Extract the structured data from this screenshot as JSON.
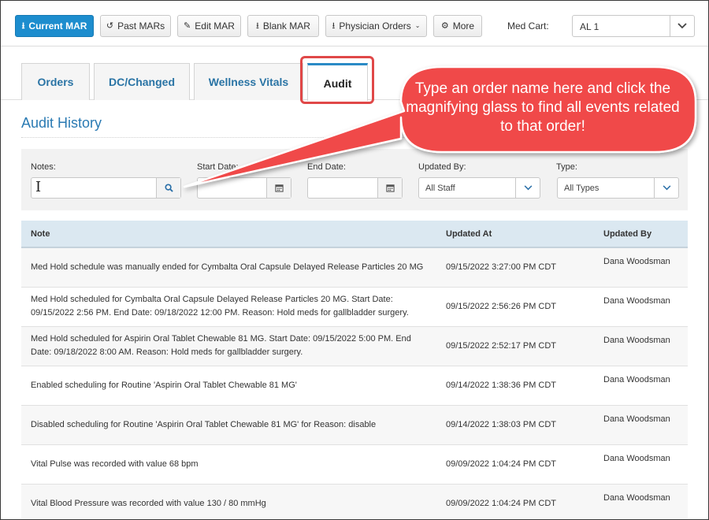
{
  "toolbar": {
    "buttons": [
      {
        "label": "Current MAR",
        "icon": "download-icon"
      },
      {
        "label": "Past MARs",
        "icon": "history-icon"
      },
      {
        "label": "Edit MAR",
        "icon": "pencil-icon"
      },
      {
        "label": "Blank MAR",
        "icon": "download-icon"
      },
      {
        "label": "Physician Orders",
        "icon": "download-icon"
      },
      {
        "label": "More",
        "icon": "gear-icon"
      }
    ],
    "med_cart_label": "Med Cart:",
    "med_cart_value": "AL 1"
  },
  "tabs": [
    {
      "label": "Orders",
      "active": false
    },
    {
      "label": "DC/Changed",
      "active": false
    },
    {
      "label": "Wellness Vitals",
      "active": false
    },
    {
      "label": "Audit",
      "active": true
    }
  ],
  "page_title": "Audit History",
  "filters": {
    "notes_label": "Notes:",
    "notes_value": "",
    "start_date_label": "Start Date:",
    "start_date_value": "",
    "end_date_label": "End Date:",
    "end_date_value": "",
    "updated_by_label": "Updated By:",
    "updated_by_value": "All Staff",
    "type_label": "Type:",
    "type_value": "All Types"
  },
  "table": {
    "columns": [
      "Note",
      "Updated At",
      "Updated By"
    ],
    "rows": [
      {
        "note": "Med Hold schedule was manually ended for Cymbalta Oral Capsule Delayed Release Particles 20 MG",
        "updated_at": "09/15/2022 3:27:00 PM CDT",
        "updated_by": "Dana Woodsman"
      },
      {
        "note": "Med Hold scheduled for Cymbalta Oral Capsule Delayed Release Particles 20 MG. Start Date: 09/15/2022 2:56 PM. End Date: 09/18/2022 12:00 PM. Reason: Hold meds for gallbladder surgery.",
        "updated_at": "09/15/2022 2:56:26 PM CDT",
        "updated_by": "Dana Woodsman"
      },
      {
        "note": "Med Hold scheduled for Aspirin Oral Tablet Chewable 81 MG. Start Date: 09/15/2022 5:00 PM. End Date: 09/18/2022 8:00 AM. Reason: Hold meds for gallbladder surgery.",
        "updated_at": "09/15/2022 2:52:17 PM CDT",
        "updated_by": "Dana Woodsman"
      },
      {
        "note": "Enabled scheduling for Routine 'Aspirin Oral Tablet Chewable 81 MG'",
        "updated_at": "09/14/2022 1:38:36 PM CDT",
        "updated_by": "Dana Woodsman"
      },
      {
        "note": "Disabled scheduling for Routine 'Aspirin Oral Tablet Chewable 81 MG' for Reason: disable",
        "updated_at": "09/14/2022 1:38:03 PM CDT",
        "updated_by": "Dana Woodsman"
      },
      {
        "note": "Vital Pulse was recorded with value 68 bpm",
        "updated_at": "09/09/2022 1:04:24 PM CDT",
        "updated_by": "Dana Woodsman"
      },
      {
        "note": "Vital Blood Pressure was recorded with value 130 / 80 mmHg",
        "updated_at": "09/09/2022 1:04:24 PM CDT",
        "updated_by": "Dana Woodsman"
      }
    ]
  },
  "callout": {
    "text": "Type an order name here and click the magnifying glass to find all events related to that order!"
  },
  "colors": {
    "primary_button": "#1d8dce",
    "link_blue": "#2a74a5",
    "callout_red": "#f04848",
    "highlight_red": "#e04848",
    "table_header": "#dbe8f1"
  }
}
